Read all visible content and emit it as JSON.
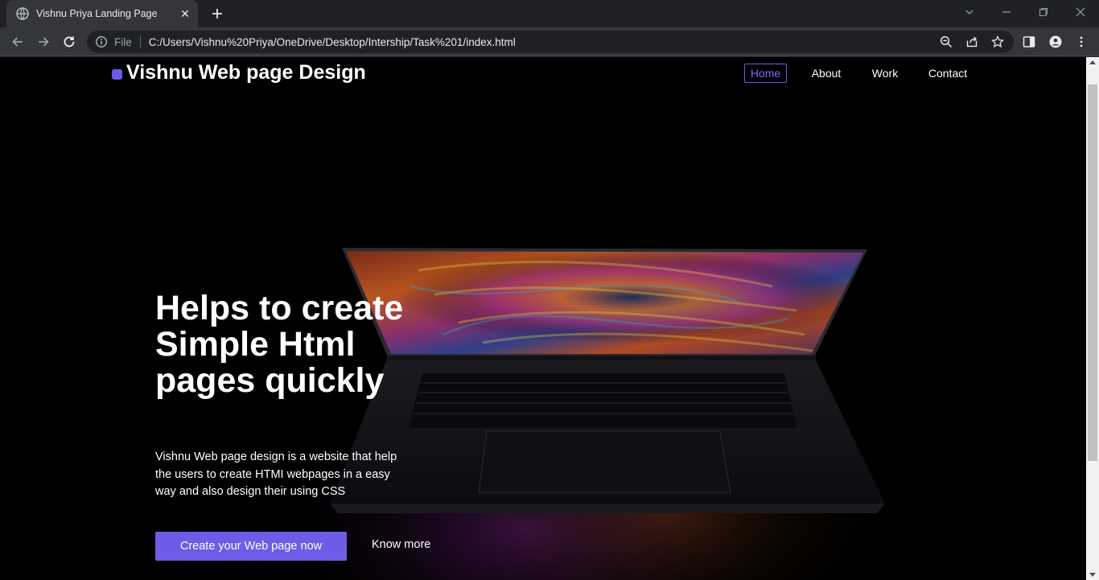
{
  "browser": {
    "tab_title": "Vishnu Priya Landing Page",
    "scheme_label": "File",
    "url": "C:/Users/Vishnu%20Priya/OneDrive/Desktop/Intership/Task%201/index.html"
  },
  "site": {
    "brand": "Vishnu Web page Design",
    "accent_color": "#6c5ce7",
    "nav": {
      "home": "Home",
      "about": "About",
      "work": "Work",
      "contact": "Contact"
    },
    "hero": {
      "title": "Helps to create Simple Html pages quickly",
      "description": "Vishnu Web page design is a website that help the users to create HTMI webpages in a easy way and also design their using CSS",
      "cta_label": "Create your Web page now",
      "secondary_label": "Know more"
    }
  }
}
